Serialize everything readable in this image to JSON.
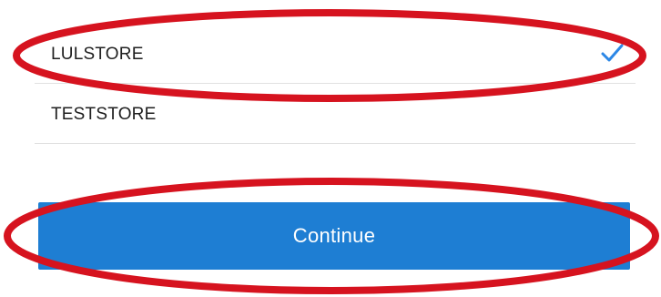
{
  "stores": [
    {
      "label": "LULSTORE",
      "selected": true
    },
    {
      "label": "TESTSTORE",
      "selected": false
    }
  ],
  "continue_button": {
    "label": "Continue"
  },
  "icons": {
    "selected": "checkmark-icon"
  },
  "colors": {
    "accent": "#1e7ed3",
    "checkmark": "#2c87e6",
    "annotation": "#d6131f",
    "divider": "#e1e1e1"
  }
}
